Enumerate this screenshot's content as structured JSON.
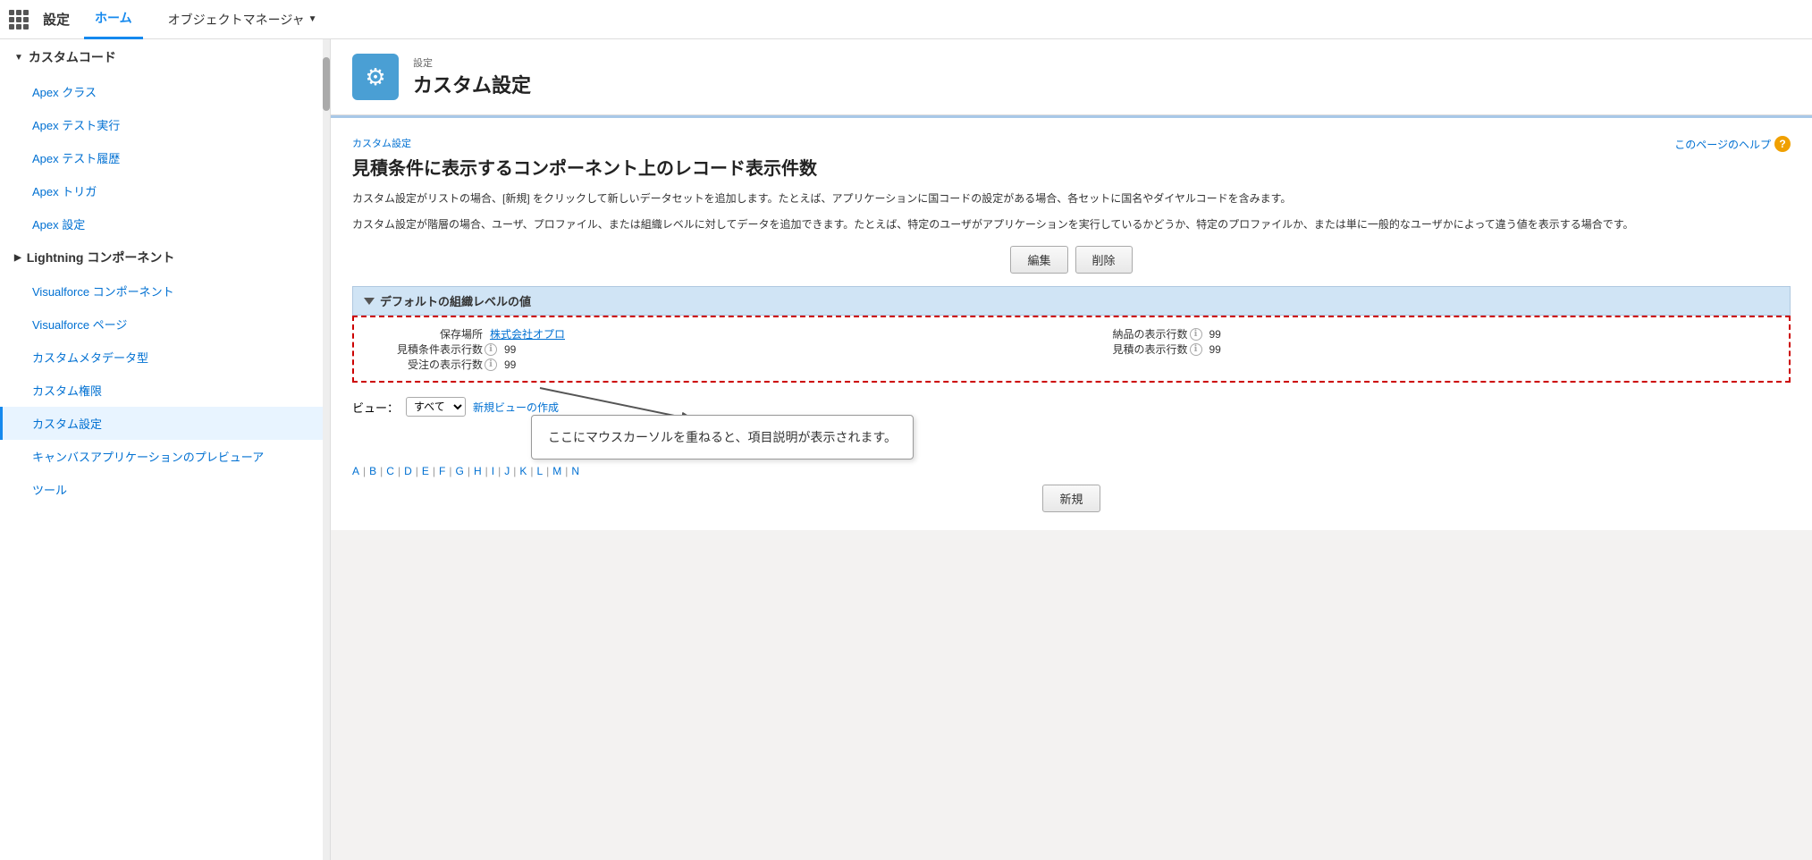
{
  "nav": {
    "grid_icon_label": "アプリランチャー",
    "app_name": "設定",
    "tabs": [
      {
        "label": "ホーム",
        "active": true
      },
      {
        "label": "オブジェクトマネージャ",
        "has_arrow": true
      }
    ]
  },
  "sidebar": {
    "sections": [
      {
        "label": "カスタムコード",
        "expanded": true,
        "items": [
          {
            "label": "Apex クラス",
            "active": false
          },
          {
            "label": "Apex テスト実行",
            "active": false
          },
          {
            "label": "Apex テスト履歴",
            "active": false
          },
          {
            "label": "Apex トリガ",
            "active": false
          },
          {
            "label": "Apex 設定",
            "active": false
          }
        ]
      },
      {
        "label": "Lightning コンポーネント",
        "expanded": false,
        "items": []
      },
      {
        "label": "Visualforce コンポーネント",
        "is_item": true
      },
      {
        "label": "Visualforce ページ",
        "is_item": true
      },
      {
        "label": "カスタムメタデータ型",
        "is_item": true
      },
      {
        "label": "カスタム権限",
        "is_item": true
      },
      {
        "label": "カスタム設定",
        "is_item": true,
        "active": true
      },
      {
        "label": "キャンバスアプリケーションのプレビューア",
        "is_item": true
      },
      {
        "label": "ツール",
        "is_item": true
      }
    ]
  },
  "page_header": {
    "icon_label": "⚙",
    "sub_label": "設定",
    "main_title": "カスタム設定"
  },
  "content": {
    "breadcrumb": "カスタム設定",
    "title": "見積条件に表示するコンポーネント上のレコード表示件数",
    "help_link": "このページのヘルプ",
    "description1": "カスタム設定がリストの場合、[新規] をクリックして新しいデータセットを追加します。たとえば、アプリケーションに国コードの設定がある場合、各セットに国名やダイヤルコードを含みます。",
    "description2": "カスタム設定が階層の場合、ユーザ、プロファイル、または組織レベルに対してデータを追加できます。たとえば、特定のユーザがアプリケーションを実行しているかどうか、特定のプロファイルか、または単に一般的なユーザかによって違う値を表示する場合です。",
    "edit_button": "編集",
    "delete_button": "削除",
    "section_label": "デフォルトの組織レベルの値",
    "data": {
      "hozon_label": "保存場所",
      "hozon_value": "株式会社オプロ",
      "kenpin_label": "納品の表示行数",
      "kenpin_value": "99",
      "mikke_label": "見積条件表示行数",
      "mikke_value": "99",
      "mitsu_label": "見積の表示行数",
      "mitsu_value": "99",
      "juchu_label": "受注の表示行数",
      "juchu_value": "99"
    },
    "view_label": "ビュー：",
    "view_option": "すべて",
    "new_view_link": "新規ビューの作成",
    "alpha_letters": [
      "A",
      "B",
      "C",
      "D",
      "E",
      "F",
      "G",
      "H",
      "I",
      "J",
      "K",
      "L",
      "M",
      "N"
    ],
    "callout_text": "ここにマウスカーソルを重ねると、項目説明が表示されます。",
    "new_button": "新規"
  }
}
